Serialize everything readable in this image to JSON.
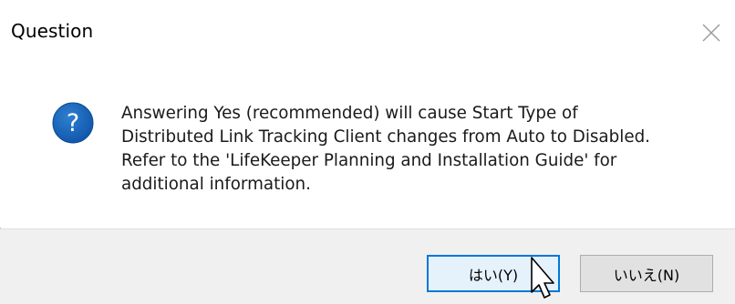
{
  "dialog": {
    "title": "Question",
    "close_icon": "close-icon",
    "icon": "question-icon",
    "message": "Answering Yes (recommended) will cause Start Type of\nDistributed Link Tracking Client changes from Auto to Disabled.\nRefer to the 'LifeKeeper Planning and Installation Guide' for\nadditional information.",
    "buttons": {
      "yes_label": "はい(Y)",
      "no_label": "いいえ(N)"
    }
  },
  "colors": {
    "accent": "#0078d7",
    "icon_blue": "#1565c0",
    "footer_bg": "#f0f0f0"
  }
}
